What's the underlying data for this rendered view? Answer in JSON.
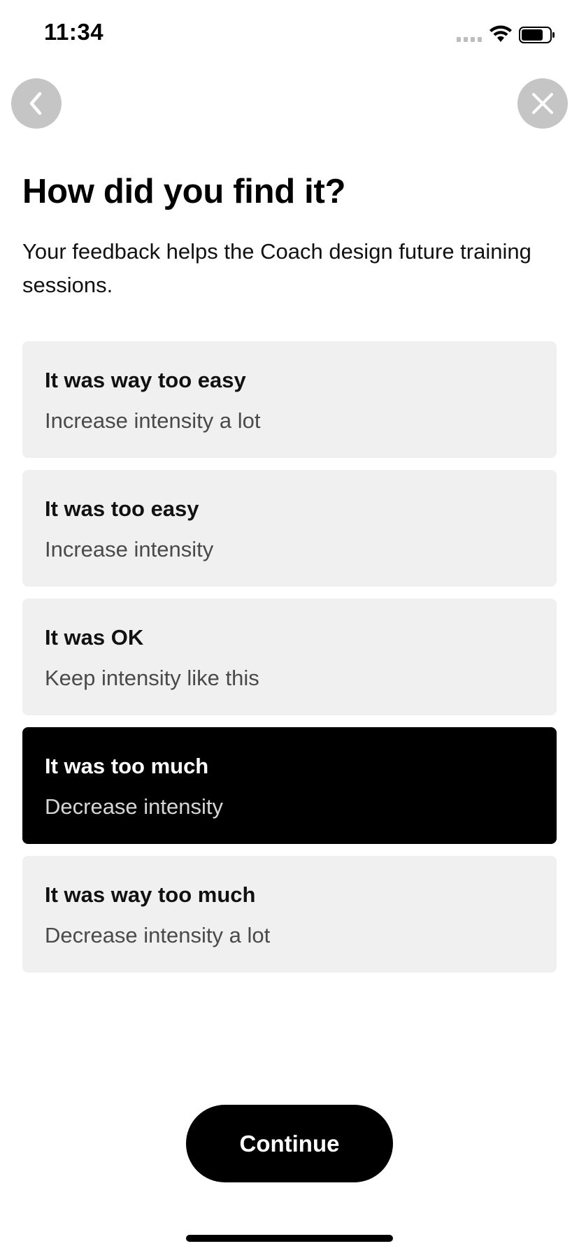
{
  "status_bar": {
    "time": "11:34"
  },
  "navigation": {
    "back_icon": "chevron-left-icon",
    "close_icon": "close-icon"
  },
  "header": {
    "title": "How did you find it?",
    "subtitle": "Your feedback helps the Coach design future training sessions."
  },
  "options": [
    {
      "title": "It was way too easy",
      "description": "Increase intensity a lot",
      "selected": false
    },
    {
      "title": "It was too easy",
      "description": "Increase intensity",
      "selected": false
    },
    {
      "title": "It was OK",
      "description": "Keep intensity like this",
      "selected": false
    },
    {
      "title": "It was too much",
      "description": "Decrease intensity",
      "selected": true
    },
    {
      "title": "It was way too much",
      "description": "Decrease intensity a lot",
      "selected": false
    }
  ],
  "footer": {
    "continue_label": "Continue"
  },
  "colors": {
    "accent": "#000000",
    "option_background": "#f0f0f0",
    "nav_button_background": "#c5c5c5"
  }
}
